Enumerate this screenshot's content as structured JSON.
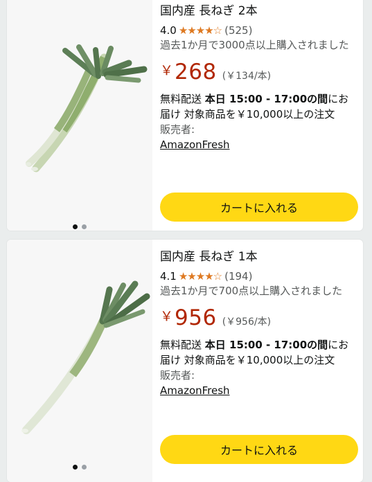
{
  "products": [
    {
      "title": "国内産 長ねぎ 2本",
      "rating": "4.0",
      "stars": "★★★★☆",
      "review_count": "(525)",
      "bought_text": "過去1か月で3000点以上購入されました",
      "currency": "￥",
      "price": "268",
      "unit_price": "(￥134/本)",
      "delivery_prefix": "無料配送 ",
      "delivery_bold": "本日 15:00 - 17:00の間",
      "delivery_suffix": "にお届け 対象商品を￥10,000以上の注文",
      "seller_label": "販売者:",
      "seller": "AmazonFresh",
      "cart_label": "カートに入れる",
      "image_icon": "green-onion-2-stalks"
    },
    {
      "title": "国内産 長ねぎ 1本",
      "rating": "4.1",
      "stars": "★★★★☆",
      "review_count": "(194)",
      "bought_text": "過去1か月で700点以上購入されました",
      "currency": "￥",
      "price": "956",
      "unit_price": "(￥956/本)",
      "delivery_prefix": "無料配送 ",
      "delivery_bold": "本日 15:00 - 17:00の間",
      "delivery_suffix": "にお届け 対象商品を￥10,000以上の注文",
      "seller_label": "販売者:",
      "seller": "AmazonFresh",
      "cart_label": "カートに入れる",
      "image_icon": "green-onion-1-stalk"
    }
  ],
  "colors": {
    "price": "#b12704",
    "star": "#de7921",
    "cart_button": "#ffd814",
    "secondary_text": "#565959"
  }
}
